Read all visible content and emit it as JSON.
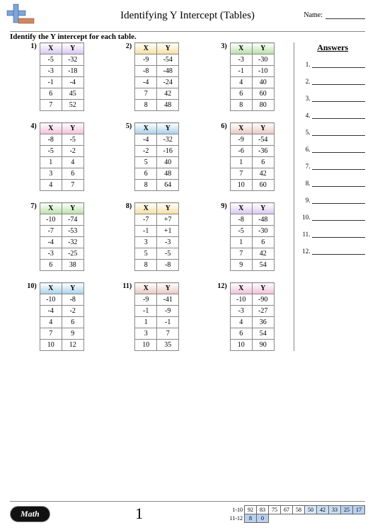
{
  "header": {
    "title": "Identifying Y Intercept (Tables)",
    "name_label": "Name:",
    "subhead": "Identify the Y intercept for each table."
  },
  "columns": {
    "x": "X",
    "y": "Y"
  },
  "problems": [
    {
      "n": "1)",
      "color": "#d8c8f0",
      "rows": [
        [
          "-5",
          "-32"
        ],
        [
          "-3",
          "-18"
        ],
        [
          "-1",
          "-4"
        ],
        [
          "6",
          "45"
        ],
        [
          "7",
          "52"
        ]
      ]
    },
    {
      "n": "2)",
      "color": "#f5e0a0",
      "rows": [
        [
          "-9",
          "-54"
        ],
        [
          "-8",
          "-48"
        ],
        [
          "-4",
          "-24"
        ],
        [
          "7",
          "42"
        ],
        [
          "8",
          "48"
        ]
      ]
    },
    {
      "n": "3)",
      "color": "#b8e0a8",
      "rows": [
        [
          "-3",
          "-30"
        ],
        [
          "-1",
          "-10"
        ],
        [
          "4",
          "40"
        ],
        [
          "6",
          "60"
        ],
        [
          "8",
          "80"
        ]
      ]
    },
    {
      "n": "4)",
      "color": "#f0c0d8",
      "rows": [
        [
          "-8",
          "-5"
        ],
        [
          "-5",
          "-2"
        ],
        [
          "1",
          "4"
        ],
        [
          "3",
          "6"
        ],
        [
          "4",
          "7"
        ]
      ]
    },
    {
      "n": "5)",
      "color": "#a8d0e8",
      "rows": [
        [
          "-4",
          "-32"
        ],
        [
          "-2",
          "-16"
        ],
        [
          "5",
          "40"
        ],
        [
          "6",
          "48"
        ],
        [
          "8",
          "64"
        ]
      ]
    },
    {
      "n": "6)",
      "color": "#e8c8c0",
      "rows": [
        [
          "-9",
          "-54"
        ],
        [
          "-6",
          "-36"
        ],
        [
          "1",
          "6"
        ],
        [
          "7",
          "42"
        ],
        [
          "10",
          "60"
        ]
      ]
    },
    {
      "n": "7)",
      "color": "#b8e0a8",
      "rows": [
        [
          "-10",
          "-74"
        ],
        [
          "-7",
          "-53"
        ],
        [
          "-4",
          "-32"
        ],
        [
          "-3",
          "-25"
        ],
        [
          "6",
          "38"
        ]
      ]
    },
    {
      "n": "8)",
      "color": "#f5e0a0",
      "rows": [
        [
          "-7",
          "+7"
        ],
        [
          "-1",
          "+1"
        ],
        [
          "3",
          "-3"
        ],
        [
          "5",
          "-5"
        ],
        [
          "8",
          "-8"
        ]
      ]
    },
    {
      "n": "9)",
      "color": "#d8c8f0",
      "rows": [
        [
          "-8",
          "-48"
        ],
        [
          "-5",
          "-30"
        ],
        [
          "1",
          "6"
        ],
        [
          "7",
          "42"
        ],
        [
          "9",
          "54"
        ]
      ]
    },
    {
      "n": "10)",
      "color": "#a8d0e8",
      "rows": [
        [
          "-10",
          "-8"
        ],
        [
          "-4",
          "-2"
        ],
        [
          "4",
          "6"
        ],
        [
          "7",
          "9"
        ],
        [
          "10",
          "12"
        ]
      ]
    },
    {
      "n": "11)",
      "color": "#e8c8c0",
      "rows": [
        [
          "-9",
          "-41"
        ],
        [
          "-1",
          "-9"
        ],
        [
          "1",
          "-1"
        ],
        [
          "3",
          "7"
        ],
        [
          "10",
          "35"
        ]
      ]
    },
    {
      "n": "12)",
      "color": "#f0c0d8",
      "rows": [
        [
          "-10",
          "-90"
        ],
        [
          "-3",
          "-27"
        ],
        [
          "4",
          "36"
        ],
        [
          "6",
          "54"
        ],
        [
          "10",
          "90"
        ]
      ]
    }
  ],
  "answers": {
    "title": "Answers",
    "count": 12
  },
  "footer": {
    "math_label": "Math",
    "page_number": "1",
    "score": {
      "row1_label": "1-10",
      "row2_label": "11-12",
      "row1": [
        "92",
        "83",
        "75",
        "67",
        "58",
        "50",
        "42",
        "33",
        "25",
        "17"
      ],
      "row2": [
        "8",
        "0"
      ]
    }
  },
  "chart_data": [
    {
      "type": "table",
      "title": "Problem 1",
      "columns": [
        "X",
        "Y"
      ],
      "rows": [
        [
          -5,
          -32
        ],
        [
          -3,
          -18
        ],
        [
          -1,
          -4
        ],
        [
          6,
          45
        ],
        [
          7,
          52
        ]
      ]
    },
    {
      "type": "table",
      "title": "Problem 2",
      "columns": [
        "X",
        "Y"
      ],
      "rows": [
        [
          -9,
          -54
        ],
        [
          -8,
          -48
        ],
        [
          -4,
          -24
        ],
        [
          7,
          42
        ],
        [
          8,
          48
        ]
      ]
    },
    {
      "type": "table",
      "title": "Problem 3",
      "columns": [
        "X",
        "Y"
      ],
      "rows": [
        [
          -3,
          -30
        ],
        [
          -1,
          -10
        ],
        [
          4,
          40
        ],
        [
          6,
          60
        ],
        [
          8,
          80
        ]
      ]
    },
    {
      "type": "table",
      "title": "Problem 4",
      "columns": [
        "X",
        "Y"
      ],
      "rows": [
        [
          -8,
          -5
        ],
        [
          -5,
          -2
        ],
        [
          1,
          4
        ],
        [
          3,
          6
        ],
        [
          4,
          7
        ]
      ]
    },
    {
      "type": "table",
      "title": "Problem 5",
      "columns": [
        "X",
        "Y"
      ],
      "rows": [
        [
          -4,
          -32
        ],
        [
          -2,
          -16
        ],
        [
          5,
          40
        ],
        [
          6,
          48
        ],
        [
          8,
          64
        ]
      ]
    },
    {
      "type": "table",
      "title": "Problem 6",
      "columns": [
        "X",
        "Y"
      ],
      "rows": [
        [
          -9,
          -54
        ],
        [
          -6,
          -36
        ],
        [
          1,
          6
        ],
        [
          7,
          42
        ],
        [
          10,
          60
        ]
      ]
    },
    {
      "type": "table",
      "title": "Problem 7",
      "columns": [
        "X",
        "Y"
      ],
      "rows": [
        [
          -10,
          -74
        ],
        [
          -7,
          -53
        ],
        [
          -4,
          -32
        ],
        [
          -3,
          -25
        ],
        [
          6,
          38
        ]
      ]
    },
    {
      "type": "table",
      "title": "Problem 8",
      "columns": [
        "X",
        "Y"
      ],
      "rows": [
        [
          -7,
          7
        ],
        [
          -1,
          1
        ],
        [
          3,
          -3
        ],
        [
          5,
          -5
        ],
        [
          8,
          -8
        ]
      ]
    },
    {
      "type": "table",
      "title": "Problem 9",
      "columns": [
        "X",
        "Y"
      ],
      "rows": [
        [
          -8,
          -48
        ],
        [
          -5,
          -30
        ],
        [
          1,
          6
        ],
        [
          7,
          42
        ],
        [
          9,
          54
        ]
      ]
    },
    {
      "type": "table",
      "title": "Problem 10",
      "columns": [
        "X",
        "Y"
      ],
      "rows": [
        [
          -10,
          -8
        ],
        [
          -4,
          -2
        ],
        [
          4,
          6
        ],
        [
          7,
          9
        ],
        [
          10,
          12
        ]
      ]
    },
    {
      "type": "table",
      "title": "Problem 11",
      "columns": [
        "X",
        "Y"
      ],
      "rows": [
        [
          -9,
          -41
        ],
        [
          -1,
          -9
        ],
        [
          1,
          -1
        ],
        [
          3,
          7
        ],
        [
          10,
          35
        ]
      ]
    },
    {
      "type": "table",
      "title": "Problem 12",
      "columns": [
        "X",
        "Y"
      ],
      "rows": [
        [
          -10,
          -90
        ],
        [
          -3,
          -27
        ],
        [
          4,
          36
        ],
        [
          6,
          54
        ],
        [
          10,
          90
        ]
      ]
    }
  ]
}
